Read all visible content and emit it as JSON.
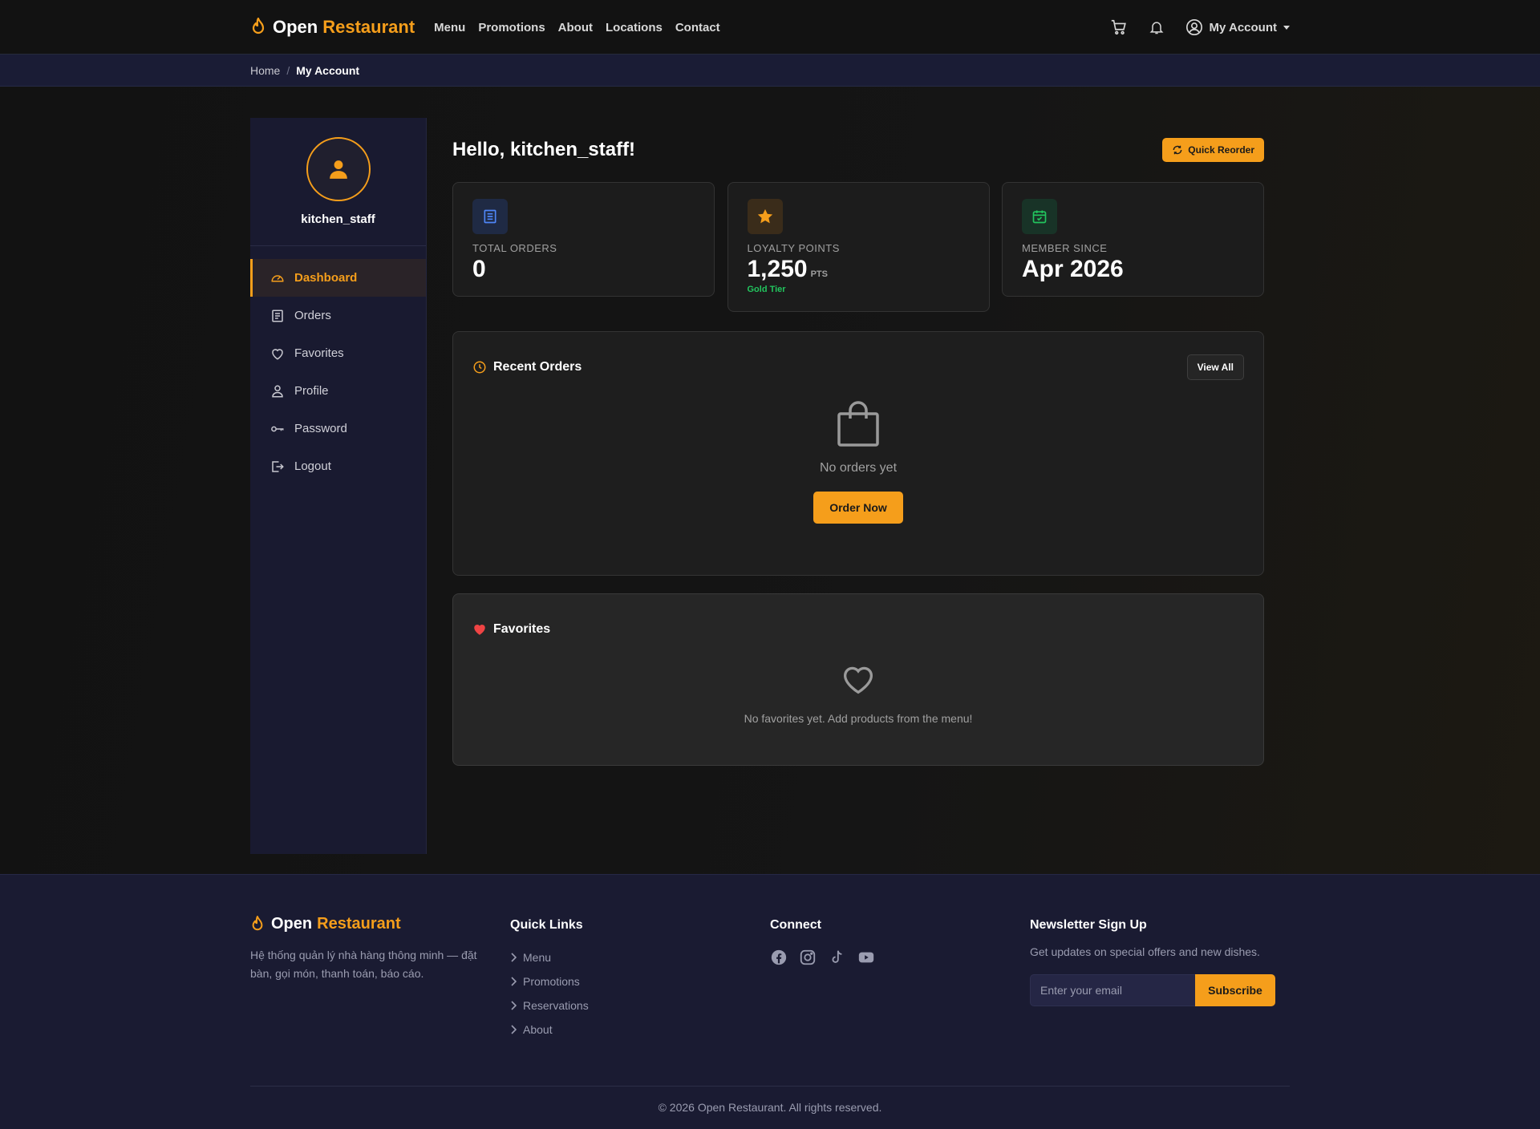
{
  "brand": {
    "name": "Open",
    "accent": "Restaurant"
  },
  "nav": {
    "links": [
      "Menu",
      "Promotions",
      "About",
      "Locations",
      "Contact"
    ],
    "account_label": "My Account"
  },
  "breadcrumb": {
    "home": "Home",
    "separator": "/",
    "current": "My Account"
  },
  "sidebar": {
    "username": "kitchen_staff",
    "items": [
      {
        "label": "Dashboard",
        "icon": "gauge-icon",
        "active": true
      },
      {
        "label": "Orders",
        "icon": "receipt-icon"
      },
      {
        "label": "Favorites",
        "icon": "heart-icon"
      },
      {
        "label": "Profile",
        "icon": "person-icon"
      },
      {
        "label": "Password",
        "icon": "key-icon"
      },
      {
        "label": "Logout",
        "icon": "logout-icon"
      }
    ]
  },
  "dashboard": {
    "greeting": "Hello, kitchen_staff!",
    "quick_reorder": "Quick Reorder",
    "stats": {
      "orders": {
        "label": "TOTAL ORDERS",
        "value": "0"
      },
      "loyalty": {
        "label": "LOYALTY POINTS",
        "value": "1,250",
        "unit": "PTS",
        "tier": "Gold Tier"
      },
      "member": {
        "label": "MEMBER SINCE",
        "value": "Apr 2026"
      }
    },
    "recent_orders": {
      "title": "Recent Orders",
      "view_all": "View All",
      "empty_text": "No orders yet",
      "order_now": "Order Now"
    },
    "favorites": {
      "title": "Favorites",
      "empty_text": "No favorites yet. Add products from the menu!"
    }
  },
  "footer": {
    "description": "Hệ thống quản lý nhà hàng thông minh — đặt bàn, gọi món, thanh toán, báo cáo.",
    "quick_links": {
      "title": "Quick Links",
      "items": [
        "Menu",
        "Promotions",
        "Reservations",
        "About"
      ]
    },
    "connect": {
      "title": "Connect",
      "icons": [
        "facebook-icon",
        "instagram-icon",
        "tiktok-icon",
        "youtube-icon"
      ]
    },
    "newsletter": {
      "title": "Newsletter Sign Up",
      "text": "Get updates on special offers and new dishes.",
      "placeholder": "Enter your email",
      "button": "Subscribe"
    },
    "copyright": "© 2026 Open Restaurant. All rights reserved."
  },
  "colors": {
    "accent": "#f59e1b",
    "sidebar_bg": "#191a30",
    "success": "#22c55e",
    "danger": "#ef4444"
  }
}
